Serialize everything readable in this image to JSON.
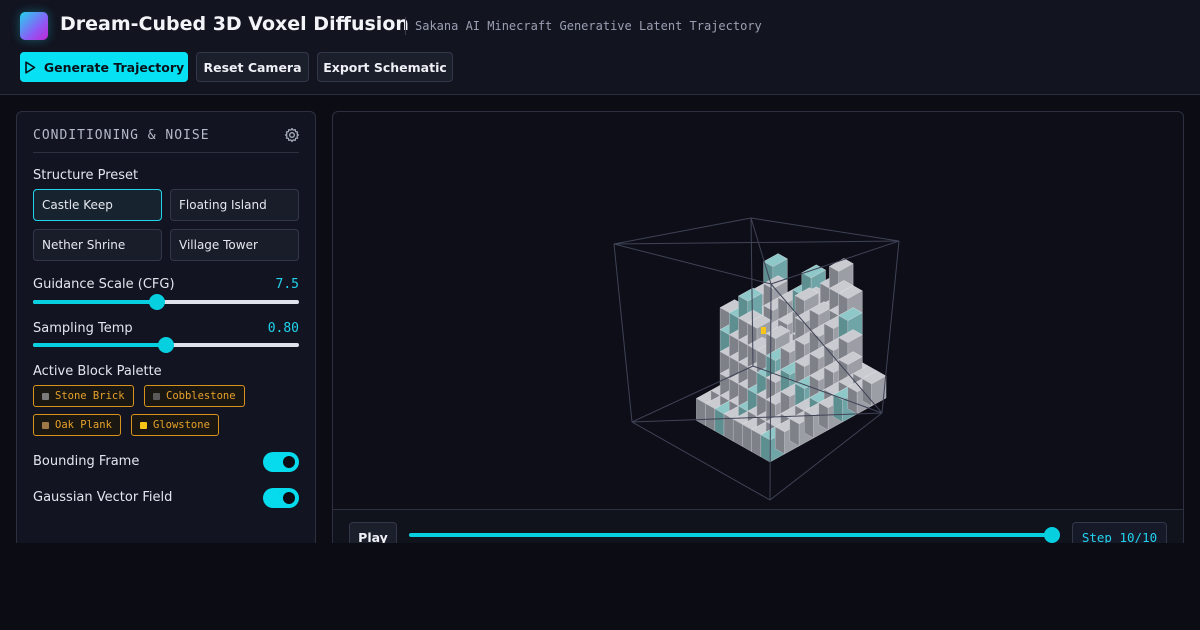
{
  "app": {
    "title": "Dream-Cubed 3D Voxel Diffusion",
    "subtitle": "Sakana AI Minecraft Generative Latent Trajectory"
  },
  "toolbar": {
    "generate_label": "Generate Trajectory",
    "reset_label": "Reset Camera",
    "export_label": "Export Schematic"
  },
  "panel": {
    "title": "CONDITIONING & NOISE",
    "preset_label": "Structure Preset",
    "presets": [
      "Castle Keep",
      "Floating Island",
      "Nether Shrine",
      "Village Tower"
    ],
    "active_preset": "Castle Keep",
    "guidance": {
      "label": "Guidance Scale (CFG)",
      "value": "7.5",
      "fraction": 0.467
    },
    "temp": {
      "label": "Sampling Temp",
      "value": "0.80",
      "fraction": 0.5
    },
    "palette_label": "Active Block Palette",
    "palette": [
      {
        "name": "Stone Brick",
        "color": "#7a7a7a"
      },
      {
        "name": "Cobblestone",
        "color": "#5a5a5a"
      },
      {
        "name": "Oak Plank",
        "color": "#a07848"
      },
      {
        "name": "Glowstone",
        "color": "#f6c518"
      }
    ],
    "toggles": [
      {
        "label": "Bounding Frame",
        "on": true
      },
      {
        "label": "Gaussian Vector Field",
        "on": true
      }
    ]
  },
  "playback": {
    "play_label": "Play",
    "step_text": "Step 10/10",
    "progress": 1.0
  },
  "colors": {
    "accent": "#06e1f3",
    "chip_border": "#d8931c"
  },
  "icons": {
    "generate": "play-icon",
    "settings": "gear-icon"
  }
}
